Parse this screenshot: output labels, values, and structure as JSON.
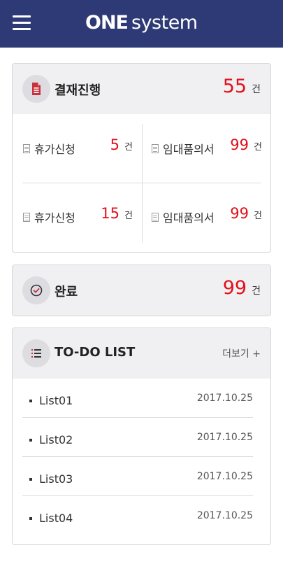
{
  "header": {
    "logo_bold": "ONE",
    "logo_light": "system",
    "menu_icon": "hamburger-menu-icon",
    "background": "#2e3a75"
  },
  "approval": {
    "icon": "document-icon",
    "title": "결재진행",
    "count": "55",
    "unit": "건",
    "items": [
      {
        "icon": "document-icon",
        "label": "휴가신청",
        "count": "5",
        "unit": "건"
      },
      {
        "icon": "document-icon",
        "label": "임대품의서",
        "count": "99",
        "unit": "건"
      },
      {
        "icon": "document-icon",
        "label": "휴가신청",
        "count": "15",
        "unit": "건"
      },
      {
        "icon": "document-icon",
        "label": "임대품의서",
        "count": "99",
        "unit": "건"
      }
    ]
  },
  "done": {
    "icon": "check-circle-icon",
    "title": "완료",
    "count": "99",
    "unit": "건"
  },
  "todo": {
    "icon": "list-icon",
    "title": "TO-DO LIST",
    "more": "더보기 +",
    "items": [
      {
        "name": "List01",
        "date": "2017.10.25"
      },
      {
        "name": "List02",
        "date": "2017.10.25"
      },
      {
        "name": "List03",
        "date": "2017.10.25"
      },
      {
        "name": "List04",
        "date": "2017.10.25"
      }
    ]
  },
  "colors": {
    "accent_red": "#e2101a",
    "header_navy": "#2e3a75",
    "card_header_bg": "#f0f0f3"
  }
}
